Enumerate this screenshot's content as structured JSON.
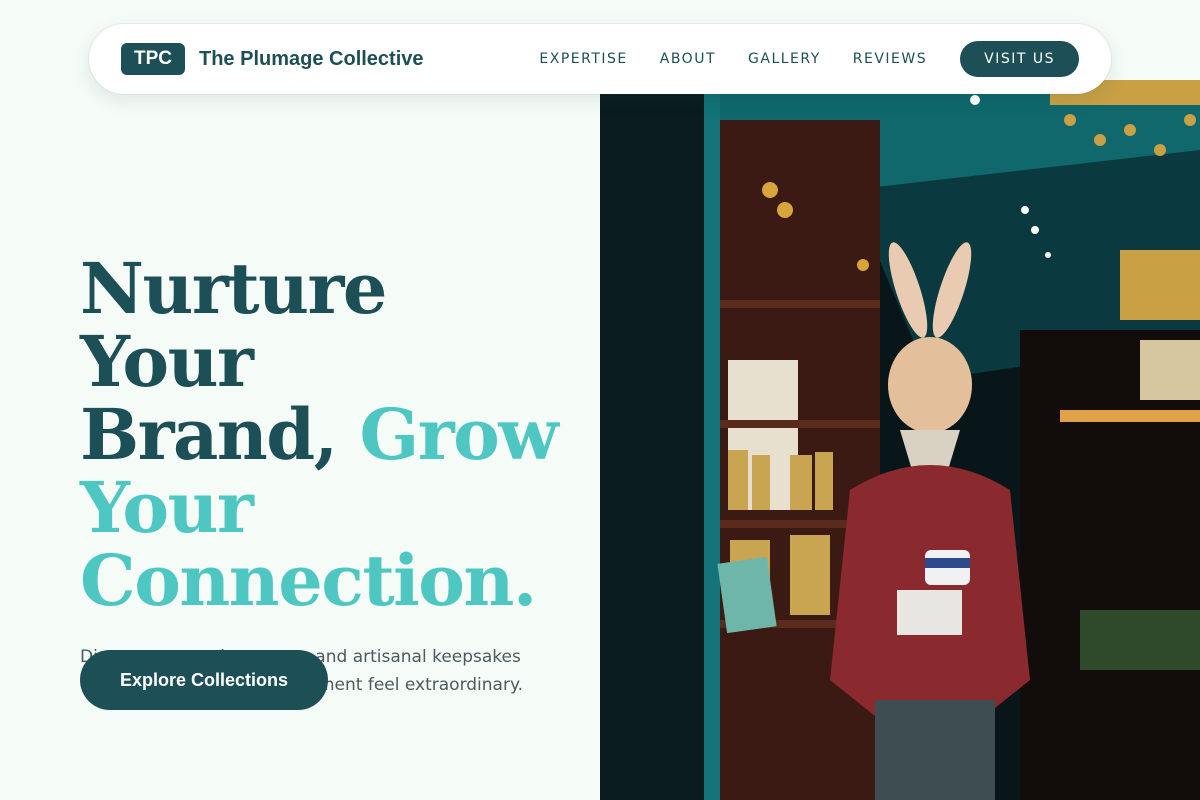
{
  "brand": {
    "badge": "TPC",
    "name": "The Plumage Collective"
  },
  "nav": {
    "links": [
      "EXPERTISE",
      "ABOUT",
      "GALLERY",
      "REVIEWS"
    ],
    "cta": "VISIT US"
  },
  "hero": {
    "headline": {
      "line1": "Nurture Your",
      "line2_plain": "Brand, ",
      "line2_accent": "Grow",
      "line3_accent": "Your",
      "line4_accent": "Connection."
    },
    "subtext": "Discover curated treasures and artisanal keepsakes designed to make every moment feel extraordinary.",
    "cta": "Explore Collections"
  },
  "colors": {
    "primary": "#1d4f57",
    "accent": "#4ec7c3",
    "background": "#f5fbf7",
    "body_text": "#4c5a5c"
  }
}
